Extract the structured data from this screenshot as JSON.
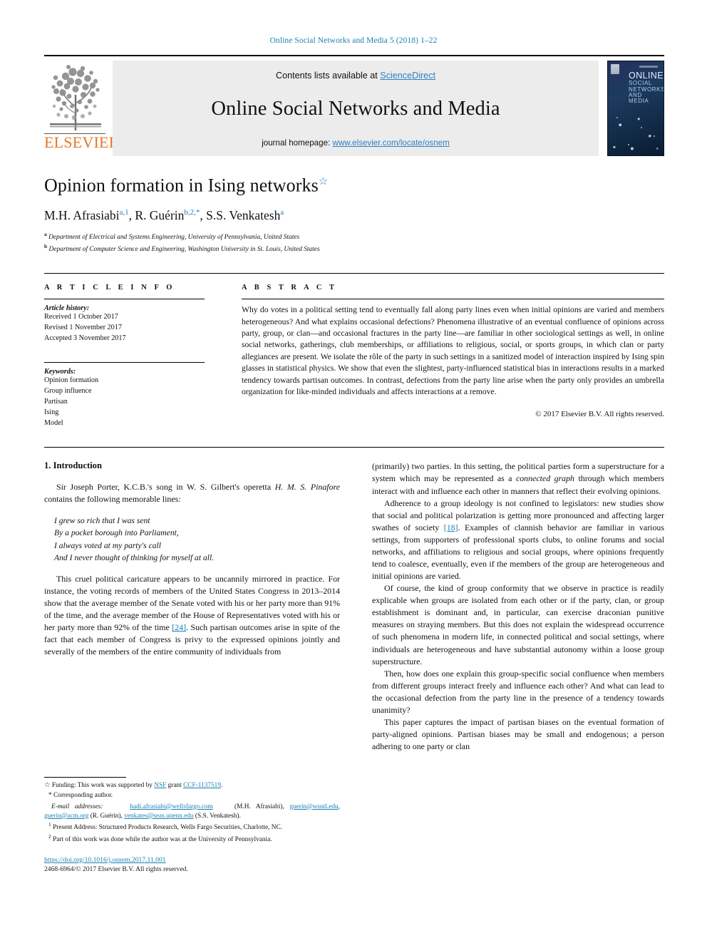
{
  "running_head": "Online Social Networks and Media 5 (2018) 1–22",
  "masthead": {
    "publisher_logo_text": "ELSEVIER",
    "contents_prefix": "Contents lists available at ",
    "contents_link": "ScienceDirect",
    "journal_title": "Online Social Networks and Media",
    "homepage_prefix": "journal homepage: ",
    "homepage_link": "www.elsevier.com/locate/osnem",
    "cover": {
      "line1": "ONLINE",
      "line2": "SOCIAL",
      "line3": "NETWORKS",
      "line4": "AND MEDIA"
    }
  },
  "article": {
    "title": "Opinion formation in Ising networks",
    "title_marker": "☆",
    "authors_html": "M.H. Afrasiabi, R. Guérin, S.S. Venkatesh",
    "authors": [
      {
        "name": "M.H. Afrasiabi",
        "marks": "a,1"
      },
      {
        "name": "R. Guérin",
        "marks": "b,2,*"
      },
      {
        "name": "S.S. Venkatesh",
        "marks": "a"
      }
    ],
    "affiliations": [
      {
        "mark": "a",
        "text": "Department of Electrical and Systems Engineering, University of Pennsylvania, United States"
      },
      {
        "mark": "b",
        "text": "Department of Computer Science and Engineering, Washington University in St. Louis, United States"
      }
    ]
  },
  "article_info": {
    "heading": "A R T I C L E   I N F O",
    "history_label": "Article history:",
    "history": [
      "Received 1 October 2017",
      "Revised 1 November 2017",
      "Accepted 3 November 2017"
    ],
    "keywords_label": "Keywords:",
    "keywords": [
      "Opinion formation",
      "Group influence",
      "Partisan",
      "Ising",
      "Model"
    ]
  },
  "abstract": {
    "heading": "A B S T R A C T",
    "text": "Why do votes in a political setting tend to eventually fall along party lines even when initial opinions are varied and members heterogeneous? And what explains occasional defections? Phenomena illustrative of an eventual confluence of opinions across party, group, or clan—and occasional fractures in the party line—are familiar in other sociological settings as well, in online social networks, gatherings, club memberships, or affiliations to religious, social, or sports groups, in which clan or party allegiances are present. We isolate the rôle of the party in such settings in a sanitized model of interaction inspired by Ising spin glasses in statistical physics. We show that even the slightest, party-influenced statistical bias in interactions results in a marked tendency towards partisan outcomes. In contrast, defections from the party line arise when the party only provides an umbrella organization for like-minded individuals and affects interactions at a remove.",
    "copyright": "© 2017 Elsevier B.V. All rights reserved."
  },
  "section": {
    "number_and_title": "1. Introduction"
  },
  "left_column": {
    "para1_a": "Sir Joseph Porter, K.C.B.'s song in W. S. Gilbert's operetta ",
    "para1_italic": "H. M. S. Pinafore",
    "para1_b": " contains the following memorable lines:",
    "verse": [
      "I grew so rich that I was sent",
      "By a pocket borough into Parliament,",
      "I always voted at my party's call",
      "And I never thought of thinking for myself at all."
    ],
    "para2_a": "This cruel political caricature appears to be uncannily mirrored in practice. For instance, the voting records of members of the United States Congress in 2013–2014 show that the average member of the Senate voted with his or her party more than 91% of the time, and the average member of the House of Representatives voted with his or her party more than 92% of the time ",
    "para2_ref": "[24]",
    "para2_b": ". Such partisan outcomes arise in spite of the fact that each member of Congress is privy to the expressed opinions jointly and severally of the members of the entire community of individuals from"
  },
  "right_column": {
    "para_cont_a": "(primarily) two parties. In this setting, the political parties form a superstructure for a system which may be represented as a ",
    "para_cont_italic": "connected graph",
    "para_cont_b": " through which members interact with and influence each other in manners that reflect their evolving opinions.",
    "para2_a": "Adherence to a group ideology is not confined to legislators: new studies show that social and political polarization is getting more pronounced and affecting larger swathes of society ",
    "para2_ref": "[18]",
    "para2_b": ". Examples of clannish behavior are familiar in various settings, from supporters of professional sports clubs, to online forums and social networks, and affiliations to religious and social groups, where opinions frequently tend to coalesce, eventually, even if the members of the group are heterogeneous and initial opinions are varied.",
    "para3": "Of course, the kind of group conformity that we observe in practice is readily explicable when groups are isolated from each other or if the party, clan, or group establishment is dominant and, in particular, can exercise draconian punitive measures on straying members. But this does not explain the widespread occurrence of such phenomena in modern life, in connected political and social settings, where individuals are heterogeneous and have substantial autonomy within a loose group superstructure.",
    "para4": "Then, how does one explain this group-specific social confluence when members from different groups interact freely and influence each other? And what can lead to the occasional defection from the party line in the presence of a tendency towards unanimity?",
    "para5": "This paper captures the impact of partisan biases on the eventual formation of party-aligned opinions. Partisan biases may be small and endogenous; a person adhering to one party or clan"
  },
  "footnotes": {
    "funding_marker": "☆",
    "funding_a": " Funding: This work was supported by ",
    "funding_agency": "NSF",
    "funding_mid": " grant ",
    "funding_grant": "CCF-1137519",
    "funding_end": ".",
    "corresponding_marker": "*",
    "corresponding_text": " Corresponding author.",
    "email_label": "E-mail addresses:",
    "emails": [
      {
        "addr": "hadi.afrasiabi@wellsfargo.com",
        "who": "(M.H. Afrasiabi)"
      },
      {
        "addr": "guerin@wustl.edu",
        "who": ""
      },
      {
        "addr": "guerin@acm.org",
        "who": "(R. Guérin)"
      },
      {
        "addr": "venkates@seas.upenn.edu",
        "who": "(S.S. Venkatesh)"
      }
    ],
    "note1_marker": "1",
    "note1": " Present Address: Structured Products Research, Wells Fargo Securities, Charlotte, NC.",
    "note2_marker": "2",
    "note2": " Part of this work was done while the author was at the University of Pennsylvania.",
    "doi": "https://doi.org/10.1016/j.osnem.2017.11.001",
    "issn_line": "2468-6964/© 2017 Elsevier B.V. All rights reserved."
  },
  "colors": {
    "link_blue": "#1a7fb5",
    "sciencedirect_blue": "#2e7fc1",
    "elsevier_orange": "#e87722"
  }
}
